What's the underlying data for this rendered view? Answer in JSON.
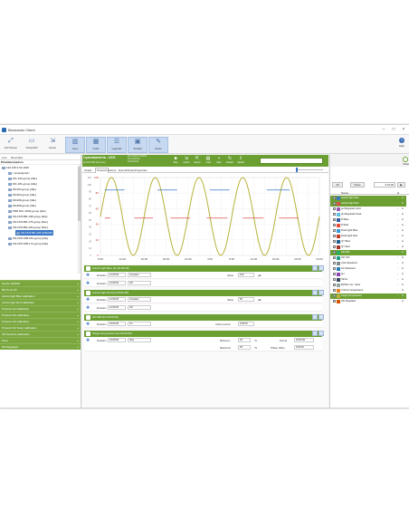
{
  "window": {
    "title": "Bioreactor Client"
  },
  "toolbar": {
    "buttons": [
      {
        "label": "Full Screen",
        "icon": "fullscreen-icon"
      },
      {
        "label": "Virtual Hbl",
        "icon": "virtual-icon"
      },
      {
        "label": "Import",
        "icon": "import-icon"
      },
      {
        "label": "Axes",
        "icon": "axes-icon"
      },
      {
        "label": "Grids",
        "icon": "grid-icon"
      },
      {
        "label": "Legends",
        "icon": "legend-icon"
      },
      {
        "label": "Tooltips",
        "icon": "tooltip-icon"
      },
      {
        "label": "Notes",
        "icon": "notes-icon"
      }
    ],
    "help_label": "Help"
  },
  "left": {
    "tabs": [
      "Live",
      "Recorded"
    ],
    "header": "Photobioreactors",
    "tree": [
      "192.168.3.54:1000",
      "<unassigned>",
      "MC-102-group [Idle]",
      "MC-181-group [Idle]",
      "MC103-group [Idle]",
      "MC204-group [Idle]",
      "MC208-group [Idle]",
      "MC208-group [Idle]",
      "PBR DF1 (095)-group [Idle]",
      "SN-FMT-BR-148-group [Idle]",
      "SN-FMT-BR-175-group [Rec]",
      "SN-FMT-BR-226-group [Rec]",
      "SN-FMT-BR-226 (#49220)",
      "SN-FMT-WB-152-group [Idle]",
      "SN-FMT-WB-174-group [Idle]"
    ],
    "groups": [
      "Device #49220",
      "Bit Pump Wi",
      "Actinic light Blue calibration",
      "Actinic light Red calibration",
      "Protocol pH calibration",
      "Protocol O2 calibration",
      "Protocol O2 calibration",
      "Protocol O2 Temp calibration",
      "OD Sensors calibration",
      "Pivot",
      "OD Regulator"
    ]
  },
  "recipe": {
    "name": "Cyanobacteria - UCS",
    "subtitle": "SN-FMT-BR-226 group",
    "times": [
      "02.10.2019 14:00:53",
      "Full 10:00:00",
      "24:00:00:00"
    ],
    "buttons": [
      "Stop",
      "Import",
      "Export",
      "Load",
      "Save",
      "Restart",
      "Upload"
    ],
    "close_label": "Close"
  },
  "center_tabs": [
    "Graph",
    "Protocol",
    "History",
    "Events/Notes",
    "Properties"
  ],
  "chart_data": {
    "type": "line",
    "x_ticks": [
      "8:00",
      "10:00",
      "12:00",
      "14:00",
      "16:00",
      "18:00",
      "20:00",
      "22:00",
      "24:00",
      "2:00",
      "4:00",
      "6:00",
      "8:00",
      "10:00",
      "12:00",
      "14:00",
      "16:00",
      "18:00",
      "20:00",
      "22:00",
      "24:00"
    ],
    "y_ticks": [
      "100",
      "80",
      "60",
      "40",
      "20",
      "0"
    ],
    "y_ticks_right": [
      "110",
      "100",
      "90",
      "80",
      "70",
      "60",
      "50",
      "40",
      "30",
      "20",
      "10",
      "0"
    ],
    "ylim": [
      0,
      100
    ],
    "series": [
      {
        "color": "#b8b23a",
        "values": [
          50,
          100,
          50,
          0,
          50,
          100,
          50,
          0,
          50,
          100,
          50,
          0,
          50,
          100,
          50,
          0,
          50,
          100,
          50,
          0,
          50
        ]
      },
      {
        "color": "#d9534f",
        "segments": [
          [
            0.4,
            0.9,
            48
          ],
          [
            3.1,
            4.8,
            48
          ],
          [
            6.4,
            8.2,
            48
          ],
          [
            9.7,
            11.6,
            48
          ],
          [
            13.0,
            14.9,
            48
          ],
          [
            16.3,
            18.1,
            48
          ]
        ]
      },
      {
        "color": "#3b77c7",
        "segments": [
          [
            0.4,
            2.2,
            84
          ],
          [
            5.2,
            7.0,
            84
          ],
          [
            10.0,
            11.8,
            84
          ],
          [
            15.2,
            17.3,
            84
          ]
        ]
      }
    ]
  },
  "steps": [
    {
      "header": "Actinic light Blue [1d 00:00:00]",
      "rows": [
        {
          "duration": "12:00:00",
          "mode": "Constant",
          "value_label": "Value",
          "value": "100",
          "unit": "µE"
        },
        {
          "duration": "12:00:00",
          "mode": "Off"
        }
      ]
    },
    {
      "header": "Actinic light Red [1d 00:00:00]",
      "rows": [
        {
          "duration": "12:00:00",
          "mode": "Constant",
          "value_label": "Value",
          "value": "50",
          "unit": "µE"
        },
        {
          "duration": "12:00:00",
          "mode": "Off"
        }
      ]
    },
    {
      "header": "OD 680 [1d 00:00:00]",
      "rows": [
        {
          "duration": "24:00:00",
          "mode": "On",
          "extra_label": "Action period",
          "extra_value": "0:05:00"
        }
      ]
    },
    {
      "header": "Target temperature [1d 00:00:00]",
      "rows": [
        {
          "duration": "24:00:00",
          "mode": "Sine",
          "min_label": "Minimum",
          "min": "22",
          "max_label": "Maximum",
          "max": "35",
          "unit": "°C",
          "period_label": "Period",
          "period": "24:00:00",
          "phase_label": "Phase offset",
          "phase": "6:00:00"
        }
      ]
    }
  ],
  "labels": {
    "duration": "Duration"
  },
  "right": {
    "all_label": "All",
    "none_label": "None",
    "search_value": "0:01:00",
    "col_name": "Name",
    "col_h": "H",
    "items": [
      {
        "name": "Actinic light blue",
        "color": "#3b77c7",
        "hl": true
      },
      {
        "name": "Actinic light Red",
        "color": "#d9534f",
        "hl": true
      },
      {
        "name": "pH Regulator acid",
        "color": "#9b59b6",
        "hl": false
      },
      {
        "name": "pH Regulator base",
        "color": "#5bc0de",
        "hl": false
      },
      {
        "name": "Pl Blue",
        "color": "#2c5aa0",
        "hl": false
      },
      {
        "name": "Pl Red",
        "color": "#e74c3c",
        "hl": false
      },
      {
        "name": "Flash light Blue",
        "color": "#3498db",
        "hl": false
      },
      {
        "name": "Flash light Red",
        "color": "#c0392b",
        "hl": false
      },
      {
        "name": "QY Blue",
        "color": "#1f618d",
        "hl": false
      },
      {
        "name": "QY Red",
        "color": "#a93226",
        "hl": false
      },
      {
        "name": "OD 680",
        "color": "#27ae60",
        "hl": true
      },
      {
        "name": "OD 720",
        "color": "#16a085",
        "hl": false
      },
      {
        "name": "CO2 dissolved",
        "color": "#7f8c8d",
        "hl": false
      },
      {
        "name": "O2 dissolved",
        "color": "#2980b9",
        "hl": false
      },
      {
        "name": "pH",
        "color": "#8e44ad",
        "hl": false
      },
      {
        "name": "Stirrer",
        "color": "#34495e",
        "hl": false
      },
      {
        "name": "Bubble mix. valve",
        "color": "#95a5a6",
        "hl": false
      },
      {
        "name": "Current temperature",
        "color": "#e67e22",
        "hl": false
      },
      {
        "name": "Target temperature",
        "color": "#b8b23a",
        "hl": true
      },
      {
        "name": "OD Regulator",
        "color": "#d35400",
        "hl": false
      }
    ]
  }
}
